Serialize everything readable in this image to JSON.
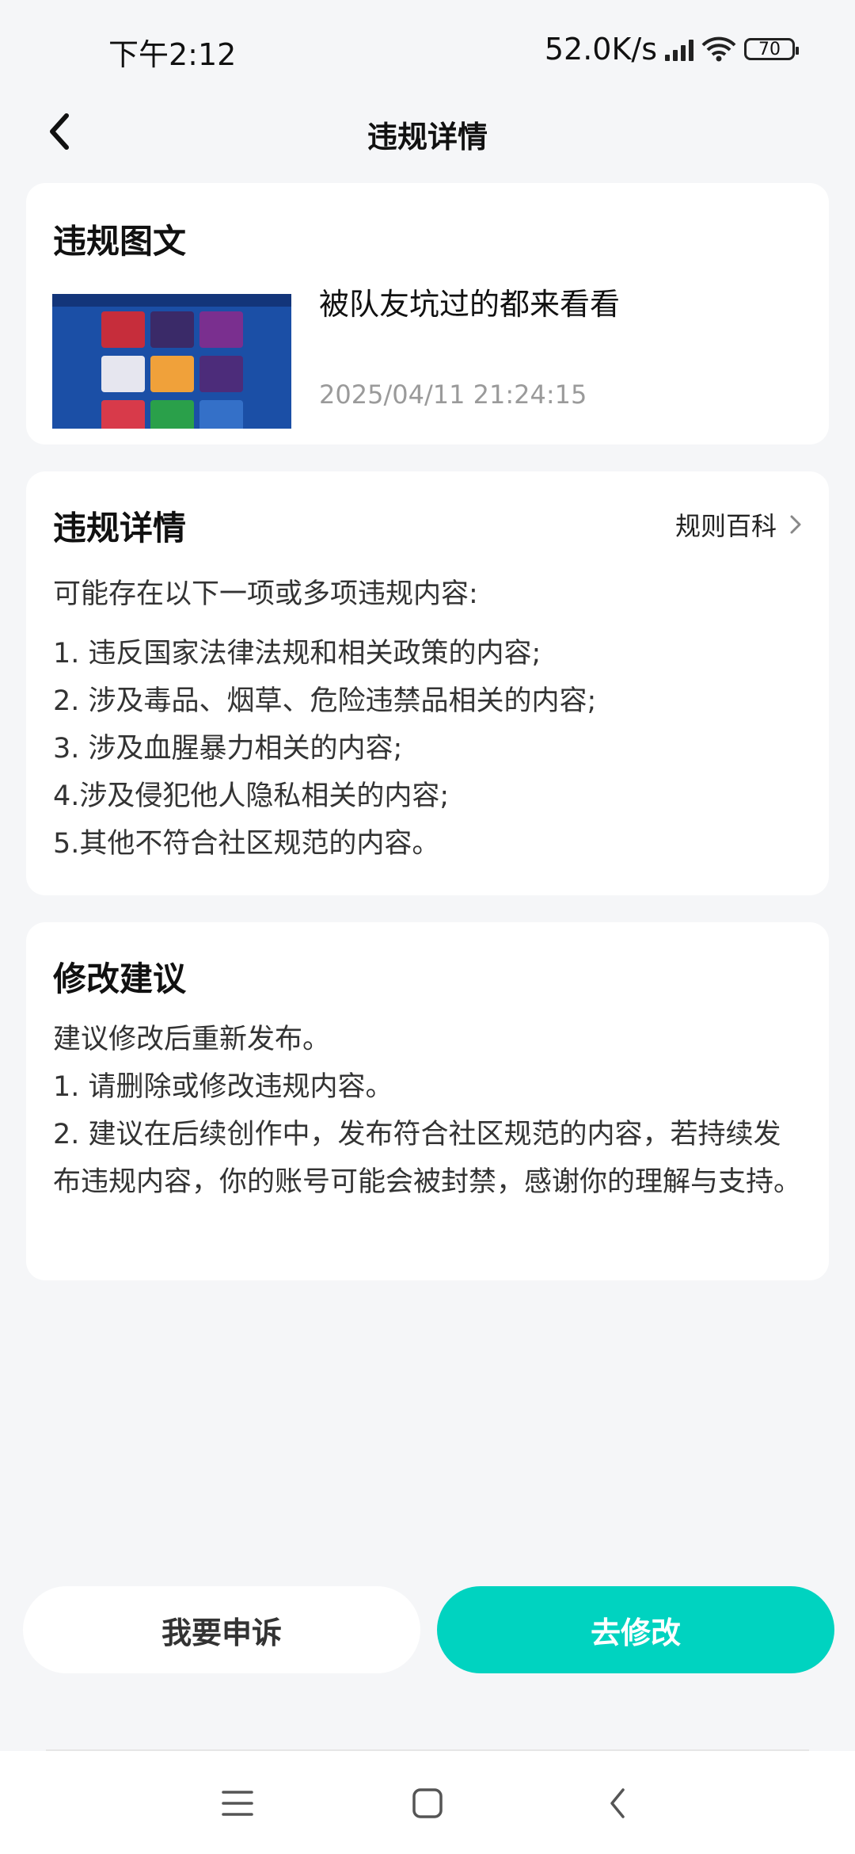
{
  "status_bar": {
    "time": "下午2:12",
    "net_speed": "52.0K/s",
    "battery": "70"
  },
  "nav": {
    "title": "违规详情",
    "back_icon": "chevron-left-icon"
  },
  "violation_content": {
    "title": "违规图文",
    "post_title": "被队友坑过的都来看看",
    "post_time": "2025/04/11 21:24:15"
  },
  "violation_detail": {
    "title": "违规详情",
    "rules_link": "规则百科",
    "intro": "可能存在以下一项或多项违规内容:",
    "items": [
      "1. 违反国家法律法规和相关政策的内容;",
      "2. 涉及毒品、烟草、危险违禁品相关的内容;",
      "3. 涉及血腥暴力相关的内容;",
      "4.涉及侵犯他人隐私相关的内容;",
      "5.其他不符合社区规范的内容。"
    ]
  },
  "suggestion": {
    "title": "修改建议",
    "text": "建议修改后重新发布。\n1. 请删除或修改违规内容。\n2. 建议在后续创作中，发布符合社区规范的内容，若持续发布违规内容，你的账号可能会被封禁，感谢你的理解与支持。"
  },
  "actions": {
    "appeal": "我要申诉",
    "modify": "去修改"
  },
  "colors": {
    "accent": "#00d3c0",
    "background": "#f5f6f8"
  }
}
